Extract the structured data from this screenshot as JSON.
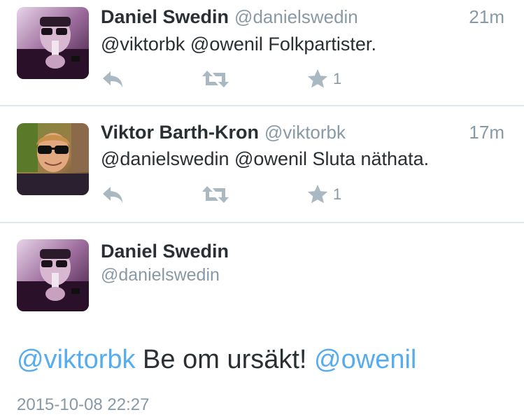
{
  "tweets": [
    {
      "name": "Daniel Swedin",
      "handle": "@danielswedin",
      "time": "21m",
      "text": "@viktorbk @owenil Folkpartister.",
      "favorite_count": "1",
      "avatar": "avatar-daniel"
    },
    {
      "name": "Viktor Barth-Kron",
      "handle": "@viktorbk",
      "time": "17m",
      "text": "@danielswedin @owenil Sluta näthata.",
      "favorite_count": "1",
      "avatar": "avatar-viktor"
    }
  ],
  "detail": {
    "name": "Daniel Swedin",
    "handle": "@danielswedin",
    "mention1": "@viktorbk",
    "body": " Be om ursäkt! ",
    "mention2": "@owenil",
    "timestamp": "2015-10-08 22:27"
  },
  "icons": [
    "reply-icon",
    "retweet-icon",
    "favorite-icon"
  ],
  "colors": {
    "link": "#55acee",
    "text": "#292f33",
    "meta": "#8899a6",
    "icon": "#aab8c2",
    "divider": "#e1e8ed"
  }
}
